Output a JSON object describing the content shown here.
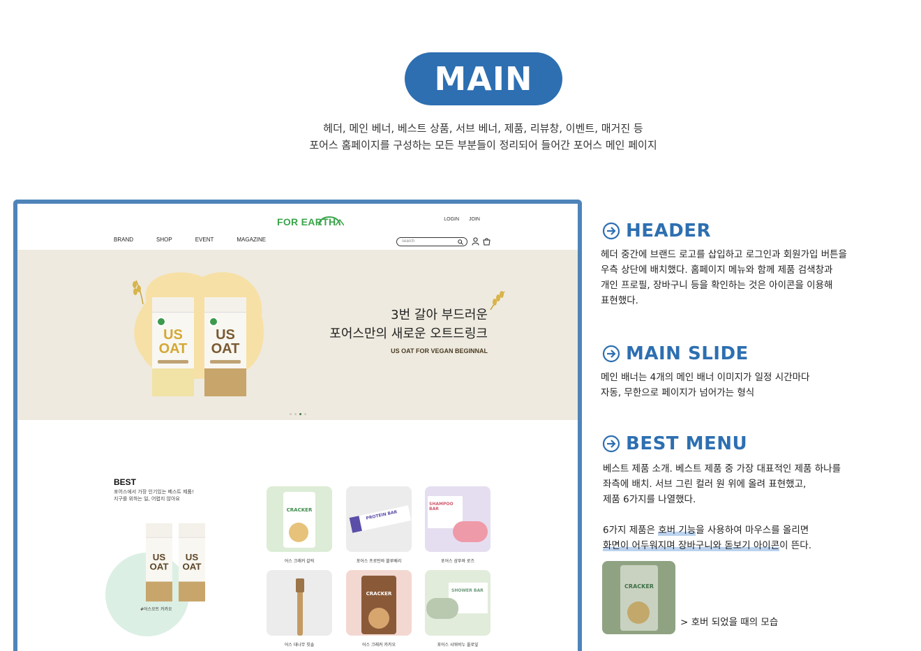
{
  "page": {
    "title": "MAIN",
    "subtitle_line1": "헤더, 메인 베너, 베스트 상품, 서브 베너, 제품, 리뷰창, 이벤트, 매거진 등",
    "subtitle_line2": "포어스 홈페이지를 구성하는 모든 부분들이 정리되어 들어간 포어스 메인 페이지"
  },
  "site": {
    "logo": "FOR EARTH",
    "auth": {
      "login": "LOGIN",
      "join": "JOIN"
    },
    "nav": [
      "BRAND",
      "SHOP",
      "EVENT",
      "MAGAZINE"
    ],
    "search_placeholder": "search",
    "icons": [
      "search-icon",
      "user-icon",
      "cart-icon"
    ]
  },
  "banner": {
    "carton_text": "US OAT",
    "headline_line1": "3번 갈아  부드러운",
    "headline_line2": "포어스만의 새로운 오트드링크",
    "tagline": "US OAT FOR VEGAN BEGINNAL",
    "slide_count": 4,
    "active_slide": 3
  },
  "best": {
    "title": "BEST",
    "desc_line1": "포어스에서 가장 인기있는 베스트 제품!",
    "desc_line2": "지구를 위하는 일, 어렵지 않아요",
    "feature_caption": "#어스오트 카카오",
    "products": [
      {
        "caption": "어스 크래커 갈릭",
        "bg": "#dcecd6",
        "label": "CRACKER"
      },
      {
        "caption": "포어스 프로틴바 블루베리",
        "bg": "#ececec",
        "label": "PROTEIN BAR"
      },
      {
        "caption": "포어스 샴푸바 로즈",
        "bg": "#e5def0",
        "label": "SHAMPOO BAR"
      },
      {
        "caption": "어스 대나무 칫솔",
        "bg": "#ececec",
        "label": ""
      },
      {
        "caption": "어스 크래커 카카오",
        "bg": "#f3d8d1",
        "label": "CRACKER"
      },
      {
        "caption": "포어스 샤워비누 올로잎",
        "bg": "#e1ecdb",
        "label": "SHOWER BAR"
      }
    ]
  },
  "sections": {
    "header": {
      "title": "HEADER",
      "lines": [
        "헤더 중간에 브랜드 로고를 삽입하고 로그인과 회원가입 버튼을",
        "우측 상단에 배치했다. 홈페이지 메뉴와 함께 제품 검색창과",
        "개인 프로필, 장바구니 등을 확인하는 것은 아이콘을 이용해",
        "표현했다."
      ]
    },
    "main_slide": {
      "title": "MAIN SLIDE",
      "lines": [
        "메인 배너는 4개의 메인 배너 이미지가 일정 시간마다",
        "자동, 무한으로 페이지가 넘어가는 형식"
      ]
    },
    "best_menu": {
      "title": "BEST MENU",
      "lines": [
        "베스트 제품 소개. 베스트 제품 중 가장 대표적인 제품 하나를",
        "좌측에 배치. 서브 그린 컬러 원 위에 올려 표현했고,",
        "제품 6가지를 나열했다."
      ],
      "hover_line1_pre": "6가지 제품은 ",
      "hover_line1_hl": "호버 기능",
      "hover_line1_post": "을 사용하여 마우스를 올리면",
      "hover_line2_hl1": "화면이 어두워지며 장바구니와 돋보기 아이콘",
      "hover_line2_post": "이 뜬다.",
      "hover_caption": "> 호버 되었을 때의 모습",
      "hover_card_label": "CRACKER"
    }
  },
  "colors": {
    "brand_blue": "#2d6fb1",
    "brand_green": "#3aa44a",
    "frame": "#4e84b9"
  }
}
